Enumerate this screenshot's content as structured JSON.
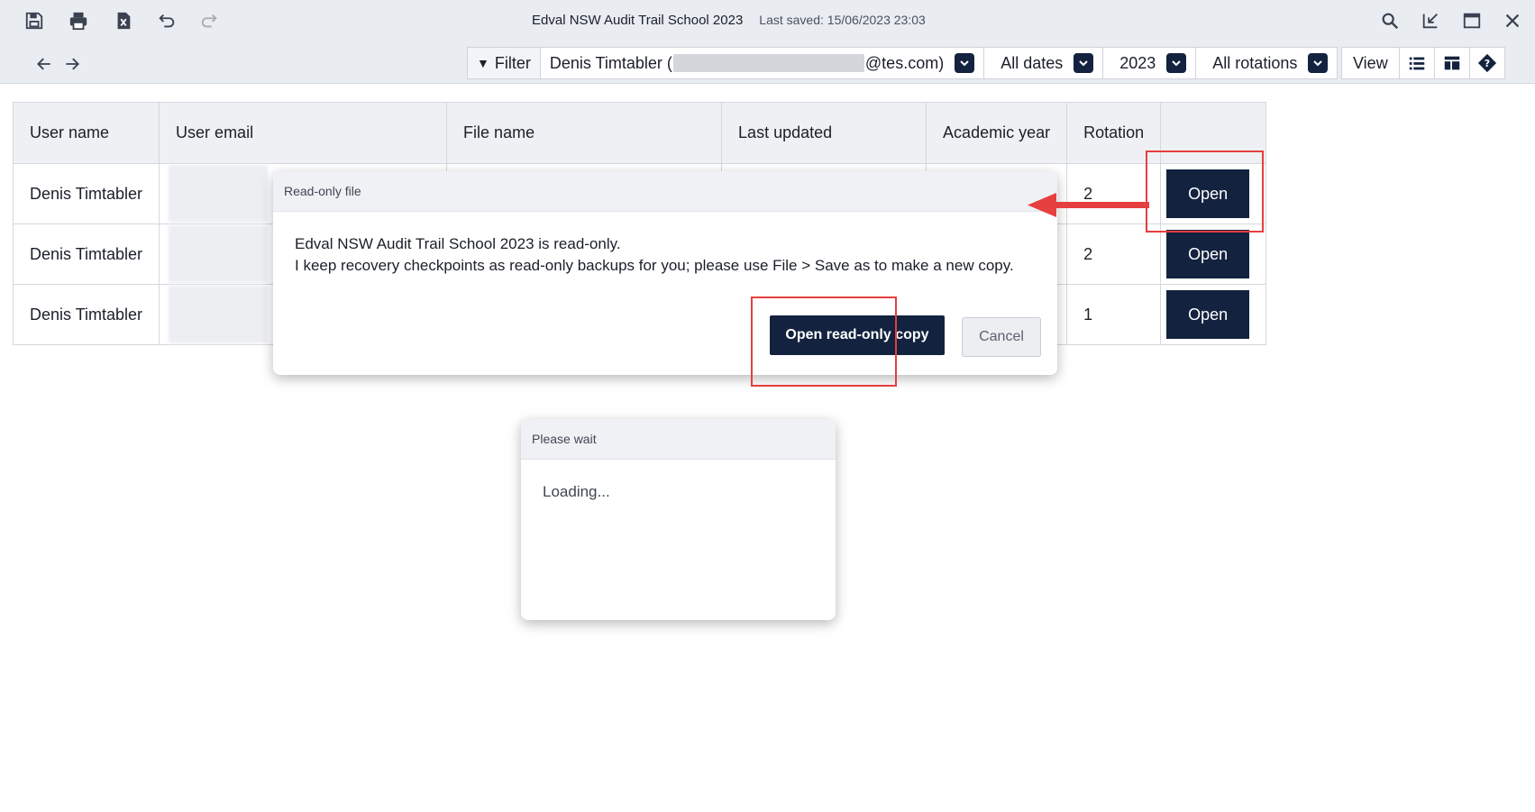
{
  "window": {
    "title": "Edval NSW Audit Trail School 2023",
    "last_saved": "Last saved: 15/06/2023 23:03",
    "toolbar_icons": [
      "save-icon",
      "print-icon",
      "excel-export-icon",
      "undo-icon",
      "redo-icon"
    ],
    "right_icons": [
      "search-icon",
      "minimize-icon",
      "maximize-icon",
      "close-icon"
    ],
    "nav_icons": [
      "back-arrow-icon",
      "forward-arrow-icon"
    ]
  },
  "filterbar": {
    "filter_label": "Filter",
    "user_prefix": "Denis Timtabler (",
    "user_suffix": "@tes.com)",
    "dates": "All dates",
    "year": "2023",
    "rotations": "All rotations"
  },
  "viewbar": {
    "view_label": "View",
    "icons": [
      "list-view-icon",
      "table-view-icon",
      "help-icon"
    ]
  },
  "table": {
    "headers": [
      "User name",
      "User email",
      "File name",
      "Last updated",
      "Academic year",
      "Rotation",
      ""
    ],
    "rows": [
      {
        "user": "Denis Timtabler",
        "rotation": "2",
        "action": "Open"
      },
      {
        "user": "Denis Timtabler",
        "rotation": "2",
        "action": "Open"
      },
      {
        "user": "Denis Timtabler",
        "rotation": "1",
        "action": "Open"
      }
    ]
  },
  "readonly_dialog": {
    "title": "Read-only file",
    "line1": "Edval NSW Audit Trail School 2023 is read-only.",
    "line2": "I keep recovery checkpoints as read-only backups for you; please use File > Save as to make a new copy.",
    "primary_button": "Open read-only copy",
    "cancel_button": "Cancel"
  },
  "wait_dialog": {
    "title": "Please wait",
    "message": "Loading..."
  },
  "colors": {
    "navy": "#13233f",
    "highlight": "#e53f3f",
    "toolbar_bg": "#e9ecf1"
  }
}
